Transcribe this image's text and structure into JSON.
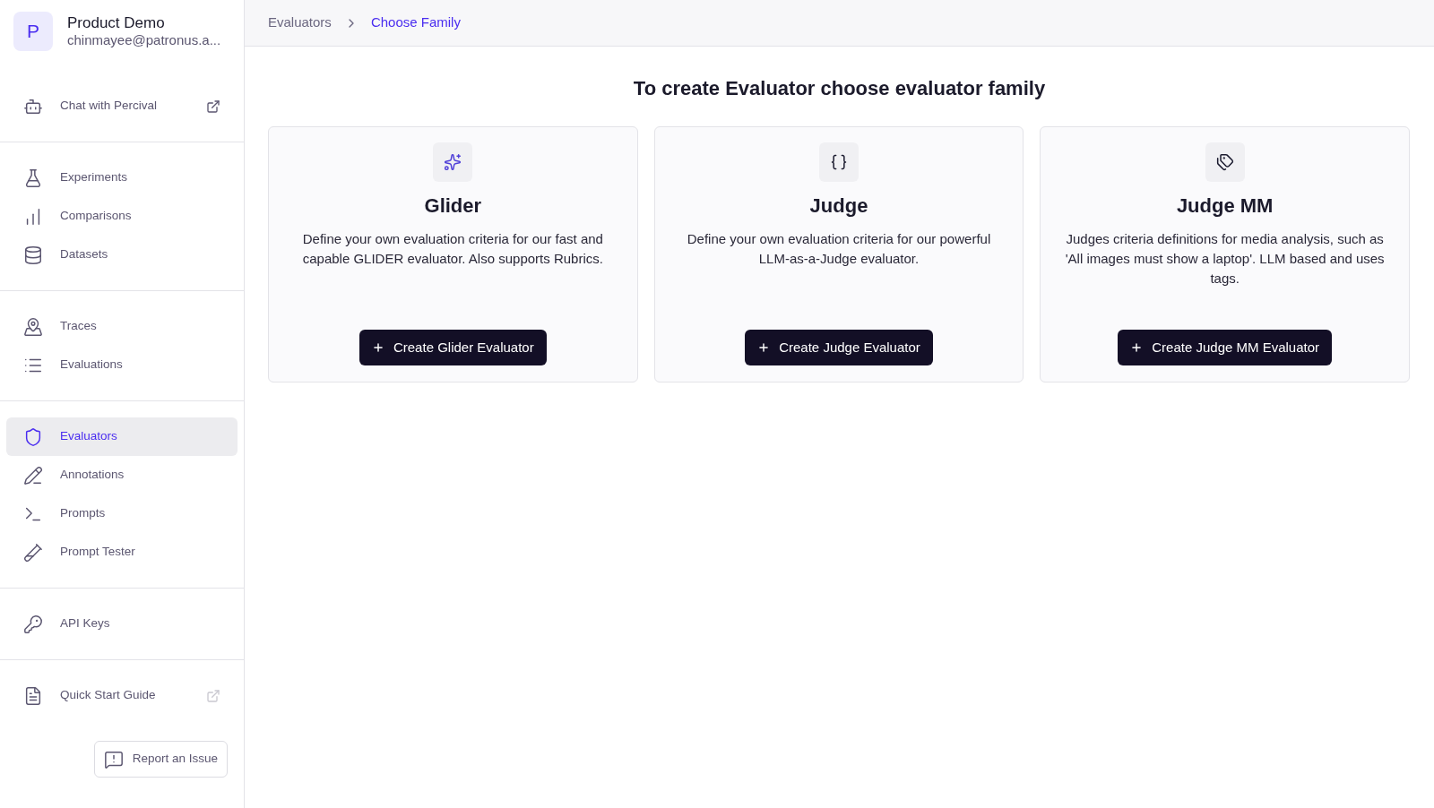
{
  "account": {
    "avatar": "P",
    "name": "Product Demo",
    "email": "chinmayee@patronus.a..."
  },
  "sidebar": {
    "groups": [
      {
        "items": [
          {
            "label": "Chat with Percival",
            "selected": false,
            "external": true
          }
        ]
      },
      {
        "items": [
          {
            "label": "Experiments",
            "selected": false,
            "external": false
          },
          {
            "label": "Comparisons",
            "selected": false,
            "external": false
          },
          {
            "label": "Datasets",
            "selected": false,
            "external": false
          }
        ]
      },
      {
        "items": [
          {
            "label": "Traces",
            "selected": false,
            "external": false
          },
          {
            "label": "Evaluations",
            "selected": false,
            "external": false
          }
        ]
      },
      {
        "items": [
          {
            "label": "Evaluators",
            "selected": true,
            "external": false
          },
          {
            "label": "Annotations",
            "selected": false,
            "external": false
          },
          {
            "label": "Prompts",
            "selected": false,
            "external": false
          },
          {
            "label": "Prompt Tester",
            "selected": false,
            "external": false
          }
        ]
      },
      {
        "items": [
          {
            "label": "API Keys",
            "selected": false,
            "external": false
          }
        ]
      },
      {
        "items": [
          {
            "label": "Quick Start Guide",
            "selected": false,
            "external": true
          }
        ]
      }
    ],
    "report_button": "Report an Issue"
  },
  "breadcrumbs": [
    {
      "label": "Evaluators",
      "selected": false
    },
    {
      "label": "Choose Family",
      "selected": true
    }
  ],
  "heading": "To create Evaluator choose evaluator family",
  "families": [
    {
      "title": "Glider",
      "description": "Define your own evaluation criteria for our fast and capable GLIDER evaluator. Also supports Rubrics.",
      "button": "Create Glider Evaluator"
    },
    {
      "title": "Judge",
      "description": "Define your own evaluation criteria for our powerful LLM-as-a-Judge evaluator.",
      "button": "Create Judge Evaluator"
    },
    {
      "title": "Judge MM",
      "description": "Judges criteria definitions for media analysis, such as 'All images must show a laptop'. LLM based and uses tags.",
      "button": "Create Judge MM Evaluator"
    }
  ]
}
